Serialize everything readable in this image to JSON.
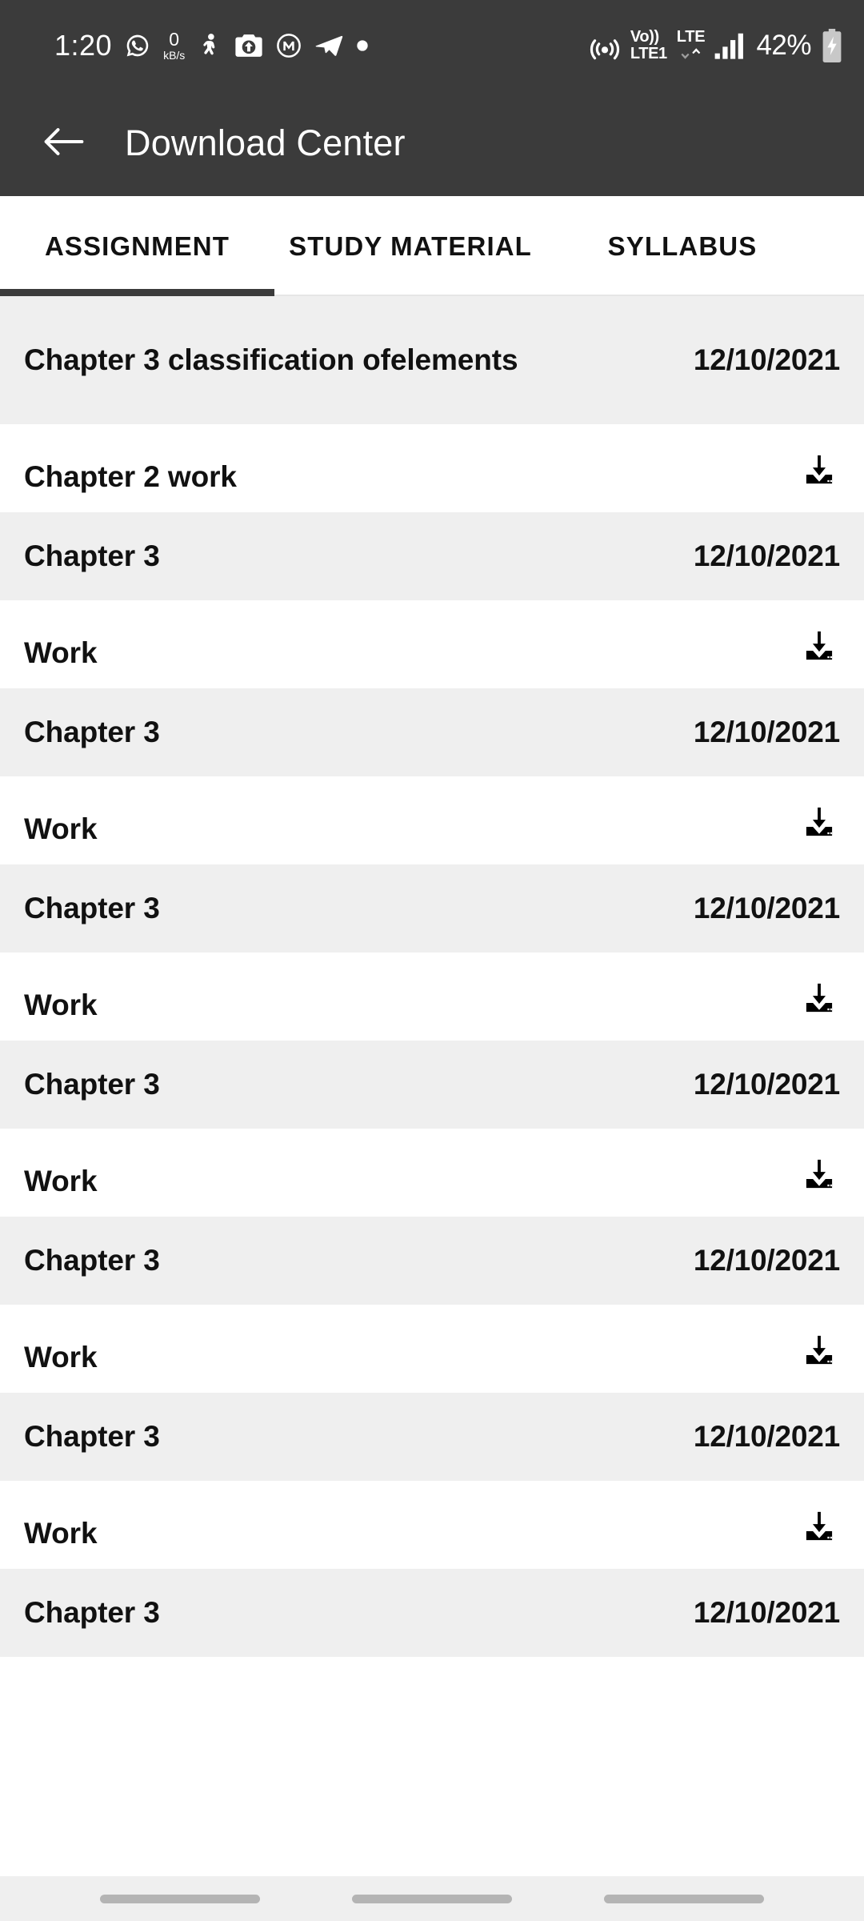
{
  "colors": {
    "bar_bg": "#3b3b3b",
    "bar_text": "#ffffff",
    "row_alt_bg": "#efefef",
    "row_bg": "#ffffff",
    "text": "#111111",
    "tab_indicator": "#3b3b3b",
    "nav_pill": "#b4b4b4"
  },
  "status_bar": {
    "clock": "1:20",
    "network_speed_value": "0",
    "network_speed_unit": "kB/s",
    "left_icons": [
      "whatsapp-icon",
      "network-speed-indicator",
      "sharechat-icon",
      "camera-upload-icon",
      "gmail-icon",
      "telegram-icon",
      "more-notifications-dot-icon"
    ],
    "right_icons": [
      "hotspot-icon",
      "volte-icon",
      "lte-data-icon",
      "signal-bars-icon",
      "battery-charging-icon"
    ],
    "volte_top": "Vo))",
    "volte_bottom": "LTE1",
    "lte_label": "LTE",
    "battery_percent": "42%"
  },
  "app_bar": {
    "back_icon": "back-arrow-icon",
    "title": "Download Center"
  },
  "tabs": [
    {
      "label": "ASSIGNMENT",
      "active": true
    },
    {
      "label": "STUDY MATERIAL",
      "active": false
    },
    {
      "label": "SYLLABUS",
      "active": false
    }
  ],
  "list": {
    "download_icon": "download-icon",
    "items": [
      {
        "title": "Chapter 3 classification ofelements",
        "date": "12/10/2021",
        "subtitle": "Chapter 2 work"
      },
      {
        "title": "Chapter 3",
        "date": "12/10/2021",
        "subtitle": "Work"
      },
      {
        "title": "Chapter 3",
        "date": "12/10/2021",
        "subtitle": "Work"
      },
      {
        "title": "Chapter 3",
        "date": "12/10/2021",
        "subtitle": "Work"
      },
      {
        "title": "Chapter 3",
        "date": "12/10/2021",
        "subtitle": "Work"
      },
      {
        "title": "Chapter 3",
        "date": "12/10/2021",
        "subtitle": "Work"
      },
      {
        "title": "Chapter 3",
        "date": "12/10/2021",
        "subtitle": "Work"
      },
      {
        "title": "Chapter 3",
        "date": "12/10/2021",
        "subtitle": ""
      }
    ]
  },
  "nav_bar": {
    "pills": [
      "recents-pill",
      "home-pill",
      "back-pill"
    ]
  }
}
